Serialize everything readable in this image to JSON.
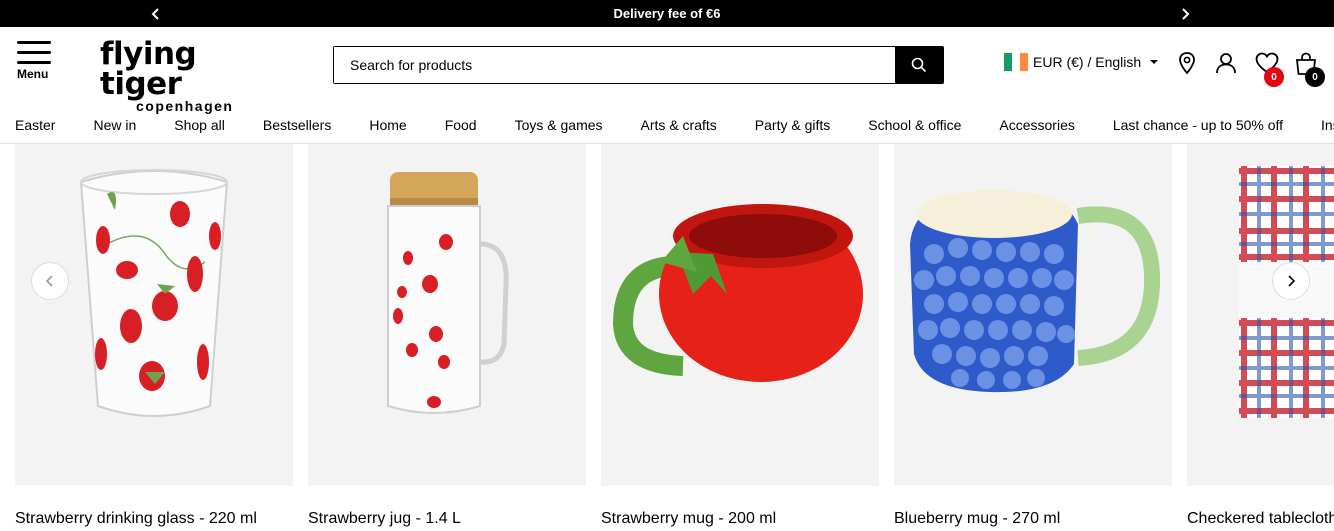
{
  "promo": {
    "text": "Delivery fee of €6"
  },
  "header": {
    "menu_label": "Menu",
    "logo_main": "flying tiger",
    "logo_sub": "copenhagen",
    "search_placeholder": "Search for products",
    "locale": "EUR (€) / English",
    "wishlist_count": "0",
    "cart_count": "0"
  },
  "nav": [
    "Easter",
    "New in",
    "Shop all",
    "Bestsellers",
    "Home",
    "Food",
    "Toys & games",
    "Arts & crafts",
    "Party & gifts",
    "School & office",
    "Accessories",
    "Last chance - up to 50% off",
    "Inspiration"
  ],
  "products": [
    {
      "name": "Strawberry drinking glass - 220 ml"
    },
    {
      "name": "Strawberry jug - 1.4 L"
    },
    {
      "name": "Strawberry mug - 200 ml"
    },
    {
      "name": "Blueberry mug - 270 ml"
    },
    {
      "name": "Checkered tablecloth"
    }
  ],
  "colors": {
    "badge_red": "#e30613",
    "badge_black": "#000000",
    "flag": [
      "#169b62",
      "#ffffff",
      "#ff883e"
    ]
  }
}
